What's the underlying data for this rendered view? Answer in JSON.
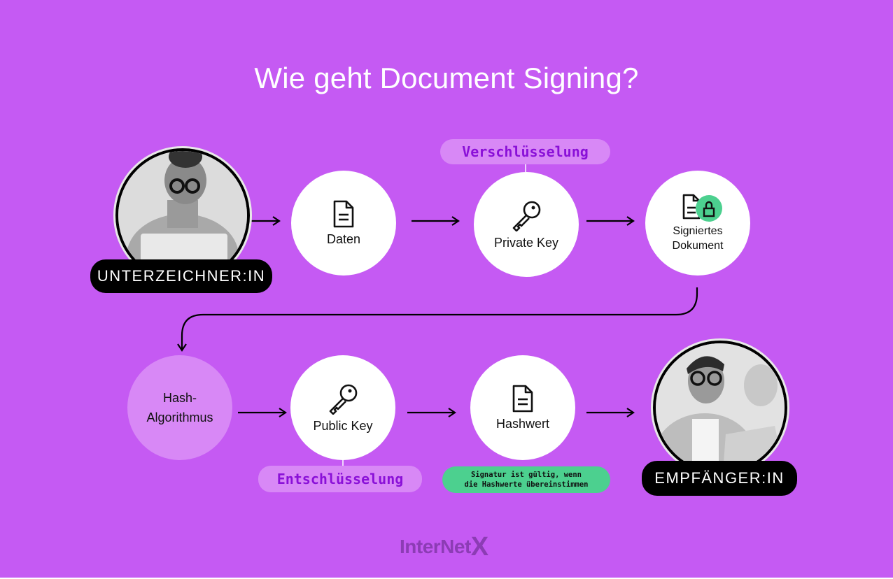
{
  "title": "Wie geht Document Signing?",
  "colors": {
    "background": "#c55af3",
    "node": "#ffffff",
    "node_light": "#d888f6",
    "tag_text": "#8a10d8",
    "note_bg": "#4cd08f",
    "badge_bg": "#000000"
  },
  "signer": {
    "label": "UNTERZEICHNER:IN",
    "image": "woman-with-laptop-photo"
  },
  "recipient": {
    "label": "EMPFÄNGER:IN",
    "image": "man-with-laptop-photo"
  },
  "steps_row1": [
    {
      "label": "Daten",
      "icon": "document-icon"
    },
    {
      "label": "Private Key",
      "icon": "key-icon"
    },
    {
      "label": "Signiertes Dokument",
      "line1": "Signiertes",
      "line2": "Dokument",
      "icon": "document-lock-icon"
    }
  ],
  "steps_row2": [
    {
      "label": "Hash-Algorithmus",
      "line1": "Hash-",
      "line2": "Algorithmus"
    },
    {
      "label": "Public Key",
      "icon": "key-icon"
    },
    {
      "label": "Hashwert",
      "icon": "document-icon"
    }
  ],
  "tags": {
    "encryption": "Verschlüsselung",
    "decryption": "Entschlüsselung"
  },
  "note": {
    "line1": "Signatur ist gültig, wenn",
    "line2": "die Hashwerte übereinstimmen"
  },
  "logo": {
    "text": "InterNet",
    "mark": "X"
  }
}
